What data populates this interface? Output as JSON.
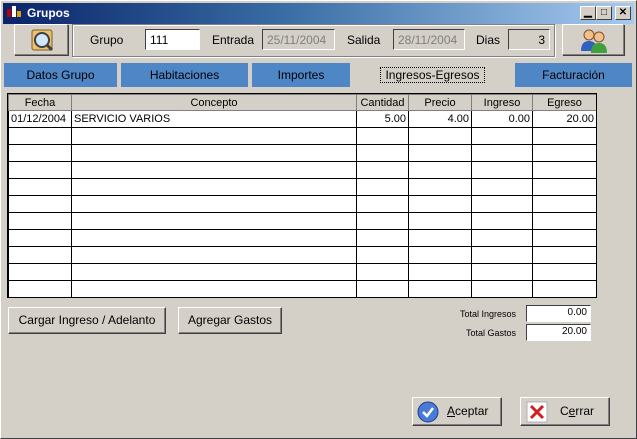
{
  "window": {
    "title": "Grupos"
  },
  "header": {
    "grupo_label": "Grupo",
    "grupo_value": "111",
    "entrada_label": "Entrada",
    "entrada_value": "25/11/2004",
    "salida_label": "Salida",
    "salida_value": "28/11/2004",
    "dias_label": "Dias",
    "dias_value": "3"
  },
  "icons": {
    "search_button": "magnifier-icon",
    "users_button": "users-icon"
  },
  "tabs": [
    {
      "label": "Datos Grupo"
    },
    {
      "label": "Habitaciones"
    },
    {
      "label": "Importes"
    },
    {
      "label": "Ingresos-Egresos"
    },
    {
      "label": "Facturación"
    }
  ],
  "active_tab": "Ingresos-Egresos",
  "grid": {
    "columns": [
      "Fecha",
      "Concepto",
      "Cantidad",
      "Precio",
      "Ingreso",
      "Egreso"
    ],
    "rows": [
      [
        "01/12/2004",
        "SERVICIO VARIOS",
        "5.00",
        "4.00",
        "0.00",
        "20.00"
      ]
    ]
  },
  "buttons": {
    "cargar": "Cargar Ingreso / Adelanto",
    "agregar": "Agregar Gastos",
    "aceptar_first": "A",
    "aceptar_rest": "ceptar",
    "cerrar_first": "C",
    "cerrar_mid": "e",
    "cerrar_rest": "rrar"
  },
  "totals": {
    "ingresos_label": "Total Ingresos",
    "ingresos_value": "0.00",
    "gastos_label": "Total Gastos",
    "gastos_value": "20.00"
  },
  "colors": {
    "tab_blue": "#4f86c6",
    "title_dark": "#0a246a",
    "face": "#d4d0c8"
  }
}
